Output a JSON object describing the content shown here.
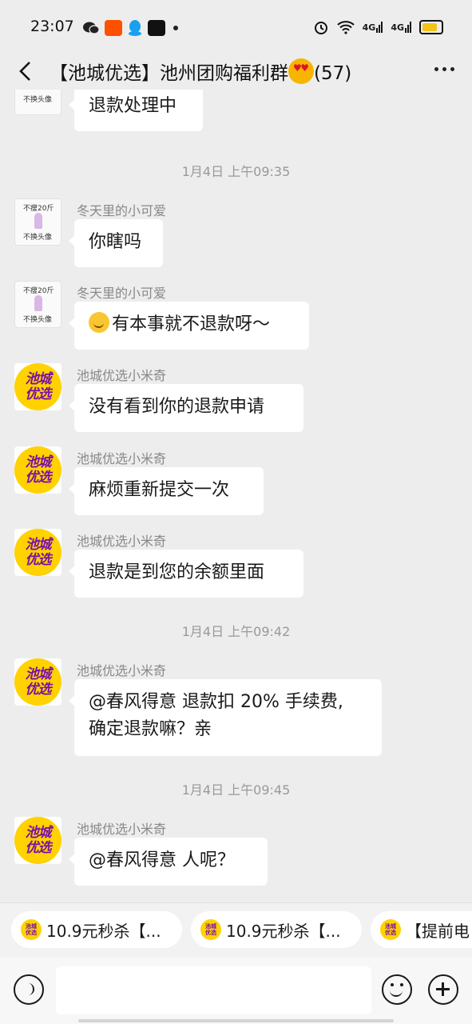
{
  "status_bar": {
    "time": "23:07",
    "left_icons": [
      "wechat-icon",
      "taobao-icon",
      "qq-icon",
      "soul-icon"
    ],
    "right_icons": [
      "alarm-icon",
      "wifi-icon",
      "signal-4g-icon",
      "signal-4g-icon",
      "battery-icon"
    ],
    "network_1": "4G",
    "network_2": "4G"
  },
  "nav": {
    "title": "【池城优选】池州团购福利群",
    "member_count": "(57)"
  },
  "messages": [
    {
      "type": "partial",
      "text": "退款处理中"
    },
    {
      "type": "time",
      "text": "1月4日 上午09:35"
    },
    {
      "type": "msg",
      "sender": "冬天里的小可爱",
      "avatar": "sticker",
      "text": "你瞎吗"
    },
    {
      "type": "msg",
      "sender": "冬天里的小可爱",
      "avatar": "sticker",
      "text": "有本事就不退款呀～"
    },
    {
      "type": "msg",
      "sender": "池城优选小米奇",
      "avatar": "brand",
      "text": "没有看到你的退款申请"
    },
    {
      "type": "msg",
      "sender": "池城优选小米奇",
      "avatar": "brand",
      "text": "麻烦重新提交一次"
    },
    {
      "type": "msg",
      "sender": "池城优选小米奇",
      "avatar": "brand",
      "text": "退款是到您的余额里面"
    },
    {
      "type": "time",
      "text": "1月4日 上午09:42"
    },
    {
      "type": "msg",
      "sender": "池城优选小米奇",
      "avatar": "brand",
      "line1": "@春风得意  退款扣 20% 手续费,",
      "line2": "确定退款嘛？亲"
    },
    {
      "type": "time",
      "text": "1月4日 上午09:45"
    },
    {
      "type": "msg",
      "sender": "池城优选小米奇",
      "avatar": "brand",
      "text": "@春风得意  人呢？"
    }
  ],
  "avatars": {
    "brand_line1": "池城",
    "brand_line2": "优选",
    "sticker_top": "不瘦20斤",
    "sticker_bottom": "不换头像"
  },
  "quick_chips": [
    "10.9元秒杀【...",
    "10.9元秒杀【...",
    "【提前电"
  ],
  "input": {
    "placeholder": ""
  },
  "colors": {
    "bubble": "#ffffff",
    "background": "#ededed",
    "brand_yellow": "#ffd200",
    "brand_purple": "#7a0fa8"
  }
}
